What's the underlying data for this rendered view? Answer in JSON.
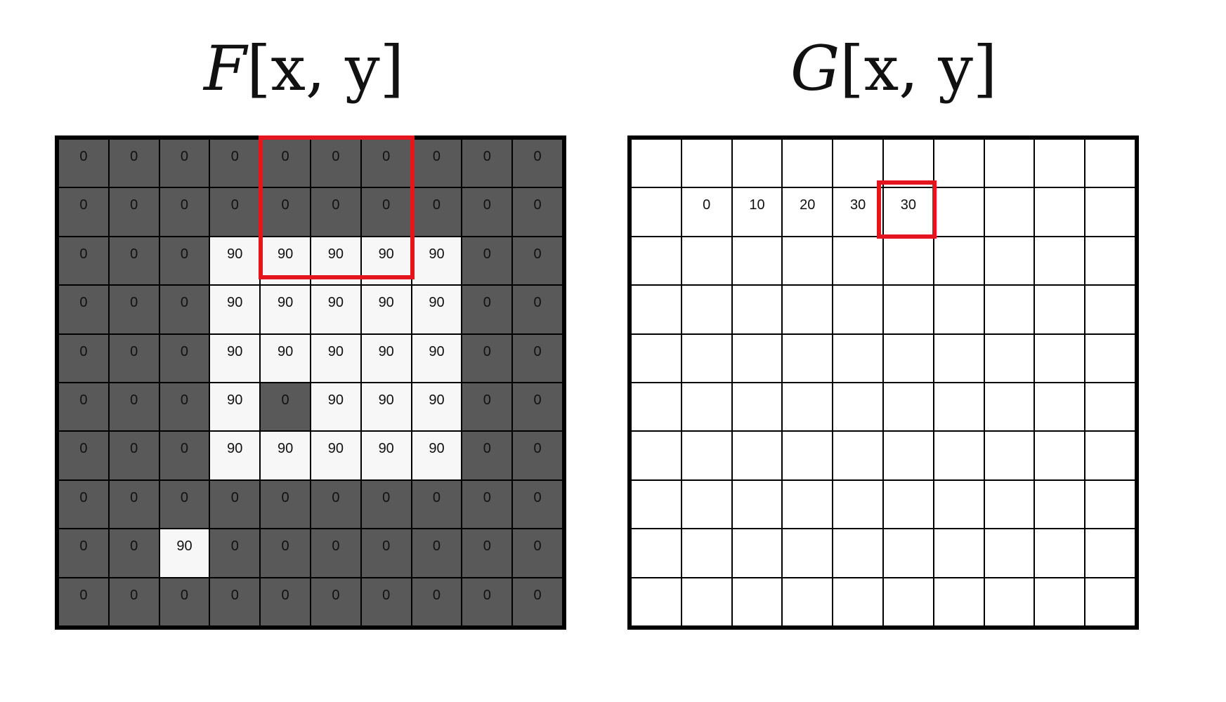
{
  "input": {
    "title": {
      "symbol": "F",
      "args": "[x, y]"
    },
    "highlight_window": {
      "row_start": 0,
      "row_end": 2,
      "col_start": 4,
      "col_end": 6
    },
    "values": [
      [
        0,
        0,
        0,
        0,
        0,
        0,
        0,
        0,
        0,
        0
      ],
      [
        0,
        0,
        0,
        0,
        0,
        0,
        0,
        0,
        0,
        0
      ],
      [
        0,
        0,
        0,
        90,
        90,
        90,
        90,
        90,
        0,
        0
      ],
      [
        0,
        0,
        0,
        90,
        90,
        90,
        90,
        90,
        0,
        0
      ],
      [
        0,
        0,
        0,
        90,
        90,
        90,
        90,
        90,
        0,
        0
      ],
      [
        0,
        0,
        0,
        90,
        0,
        90,
        90,
        90,
        0,
        0
      ],
      [
        0,
        0,
        0,
        90,
        90,
        90,
        90,
        90,
        0,
        0
      ],
      [
        0,
        0,
        0,
        0,
        0,
        0,
        0,
        0,
        0,
        0
      ],
      [
        0,
        0,
        90,
        0,
        0,
        0,
        0,
        0,
        0,
        0
      ],
      [
        0,
        0,
        0,
        0,
        0,
        0,
        0,
        0,
        0,
        0
      ]
    ]
  },
  "output": {
    "title": {
      "symbol": "G",
      "args": "[x, y]"
    },
    "highlight_cell": {
      "row": 1,
      "col": 5
    },
    "values": [
      [
        null,
        null,
        null,
        null,
        null,
        null,
        null,
        null,
        null,
        null
      ],
      [
        null,
        0,
        10,
        20,
        30,
        30,
        null,
        null,
        null,
        null
      ],
      [
        null,
        null,
        null,
        null,
        null,
        null,
        null,
        null,
        null,
        null
      ],
      [
        null,
        null,
        null,
        null,
        null,
        null,
        null,
        null,
        null,
        null
      ],
      [
        null,
        null,
        null,
        null,
        null,
        null,
        null,
        null,
        null,
        null
      ],
      [
        null,
        null,
        null,
        null,
        null,
        null,
        null,
        null,
        null,
        null
      ],
      [
        null,
        null,
        null,
        null,
        null,
        null,
        null,
        null,
        null,
        null
      ],
      [
        null,
        null,
        null,
        null,
        null,
        null,
        null,
        null,
        null,
        null
      ],
      [
        null,
        null,
        null,
        null,
        null,
        null,
        null,
        null,
        null,
        null
      ],
      [
        null,
        null,
        null,
        null,
        null,
        null,
        null,
        null,
        null,
        null
      ]
    ]
  },
  "colors": {
    "dark_cell": "#595959",
    "light_cell": "#f7f7f7",
    "highlight": "#e4151f"
  }
}
